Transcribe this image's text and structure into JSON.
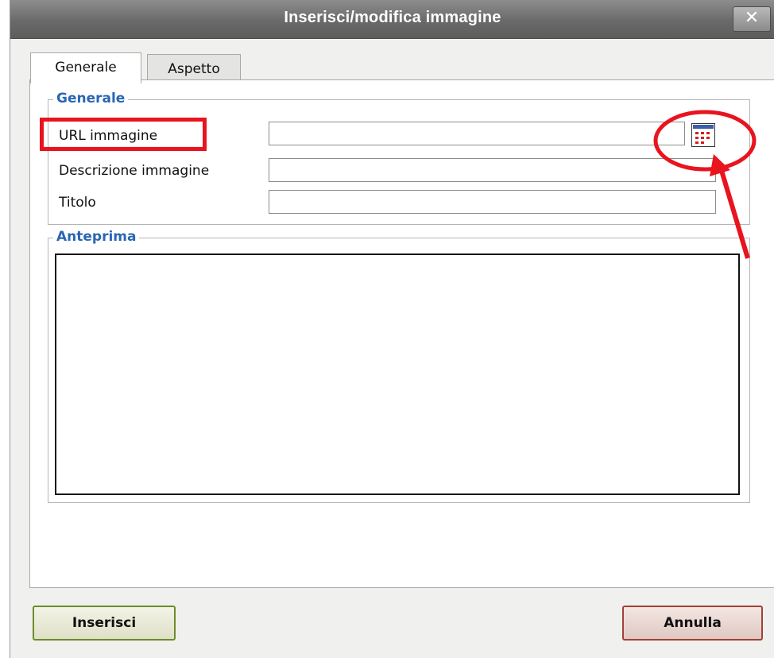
{
  "dialog": {
    "title": "Inserisci/modifica immagine",
    "close_glyph": "✕"
  },
  "tabs": [
    {
      "label": "Generale",
      "active": true
    },
    {
      "label": "Aspetto",
      "active": false
    }
  ],
  "general": {
    "legend": "Generale",
    "fields": [
      {
        "label": "URL immagine",
        "value": ""
      },
      {
        "label": "Descrizione immagine",
        "value": ""
      },
      {
        "label": "Titolo",
        "value": ""
      }
    ],
    "browse_icon": "browse-calendar-icon"
  },
  "preview": {
    "legend": "Anteprima"
  },
  "buttons": {
    "insert": "Inserisci",
    "cancel": "Annulla"
  },
  "colors": {
    "legend": "#2a66b3",
    "annotation": "#e8141e",
    "insert_border": "#6c8c28",
    "cancel_border": "#a04236"
  }
}
